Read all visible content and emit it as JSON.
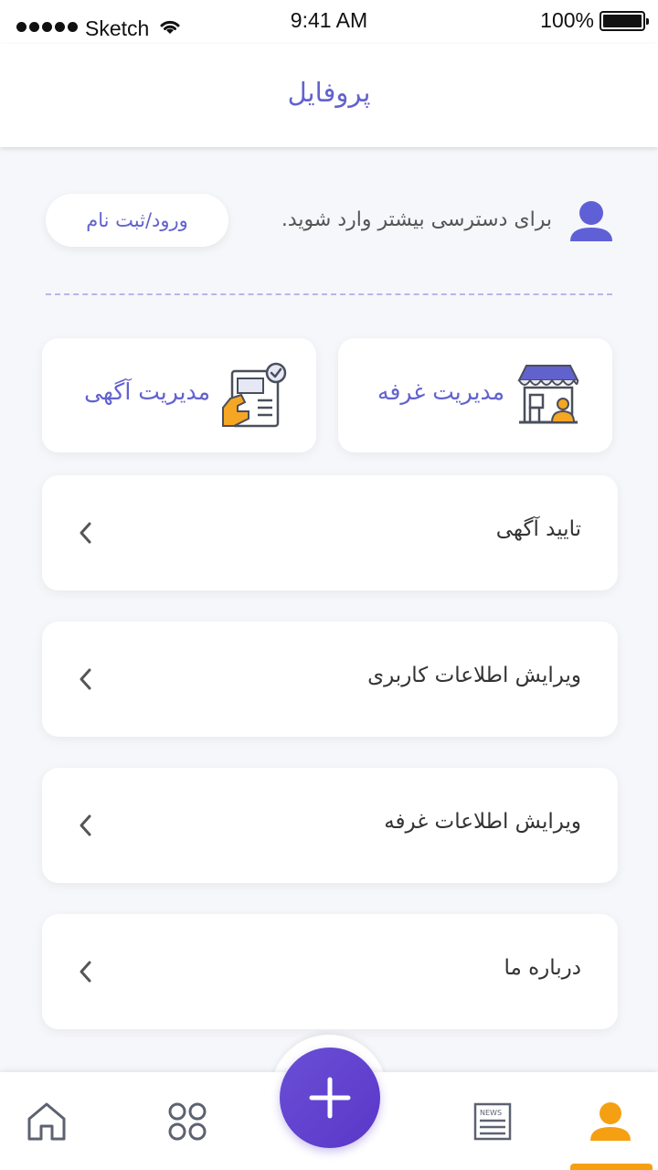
{
  "status_bar": {
    "carrier": "Sketch",
    "time": "9:41 AM",
    "battery": "100%",
    "battery_level": 1.0
  },
  "header": {
    "title": "پروفایل"
  },
  "login": {
    "message": "برای دسترسی بیشتر وارد شوید.",
    "button_label": "ورود/ثبت نام"
  },
  "feature_cards": [
    {
      "label": "مدیریت غرفه",
      "icon": "storefront-icon"
    },
    {
      "label": "مدیریت آگهی",
      "icon": "ad-document-icon"
    }
  ],
  "menu": {
    "items": [
      {
        "label": "تایید آگهی"
      },
      {
        "label": "ویرایش اطلاعات کاربری"
      },
      {
        "label": "ویرایش اطلاعات غرفه"
      },
      {
        "label": "درباره ما"
      }
    ]
  },
  "bottom_nav": {
    "news_label": "NEWS",
    "active": "profile"
  },
  "colors": {
    "accent": "#6262cf",
    "fab": "#5a37c8",
    "active": "#f5a012",
    "icon_gray": "#5c6270"
  }
}
